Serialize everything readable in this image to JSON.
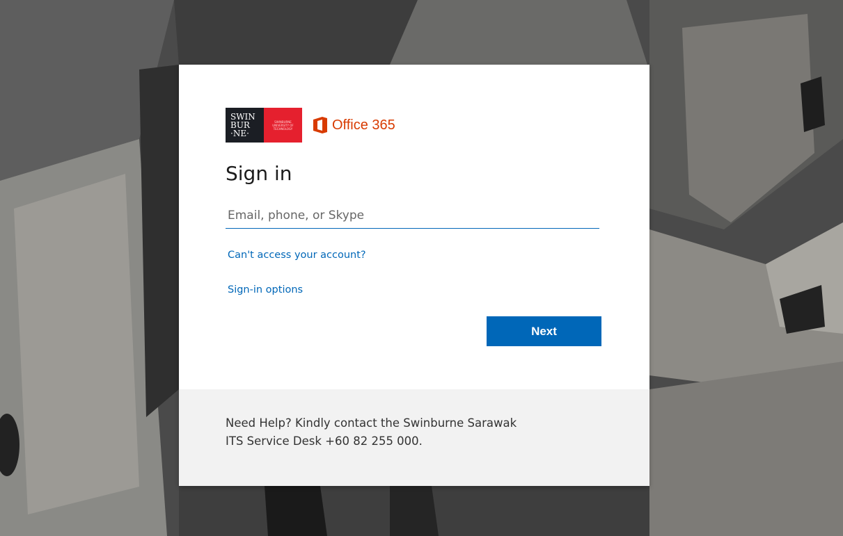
{
  "branding": {
    "swin_lines": [
      "SWIN",
      "BUR",
      "·NE·"
    ],
    "swin_subtext": [
      "SWINBURNE",
      "UNIVERSITY OF",
      "TECHNOLOGY"
    ],
    "office_text": "Office 365",
    "office_icon": "office-logo-icon"
  },
  "signin": {
    "title": "Sign in",
    "email_placeholder": "Email, phone, or Skype",
    "email_value": "",
    "cant_access_link": "Can't access your account?",
    "signin_options_link": "Sign-in options",
    "next_button": "Next"
  },
  "help": {
    "text_line1": "Need Help? Kindly contact the Swinburne Sarawak",
    "text_line2": "ITS Service Desk +60 82 255 000."
  },
  "colors": {
    "accent": "#0067b8",
    "office_orange": "#d83b01",
    "swin_red": "#e5202e",
    "swin_dark": "#1b1e24",
    "help_bg": "#f2f2f2"
  }
}
